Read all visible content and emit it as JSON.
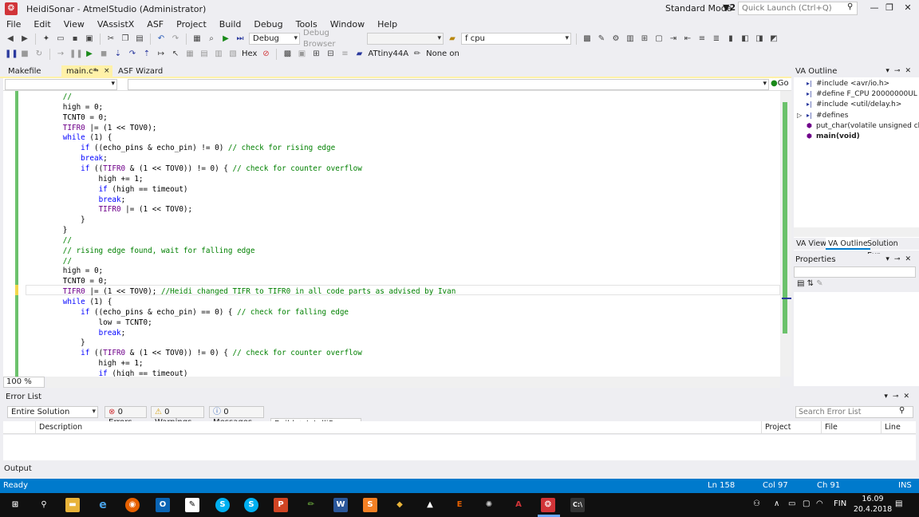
{
  "window": {
    "title": "HeidiSonar - AtmelStudio (Administrator)",
    "mode": "Standard Mode",
    "notification": "▼2",
    "quick_launch_placeholder": "Quick Launch (Ctrl+Q)",
    "minimize": "—",
    "restore": "❐",
    "close": "✕"
  },
  "menu": [
    "File",
    "Edit",
    "View",
    "VAssistX",
    "ASF",
    "Project",
    "Build",
    "Debug",
    "Tools",
    "Window",
    "Help"
  ],
  "toolbar1": {
    "config": "Debug",
    "debug_browser": "Debug Browser",
    "find_text": "f cpu"
  },
  "toolbar2": {
    "hex": "Hex",
    "device": "ATtiny44A",
    "tool": "None on"
  },
  "tabs": {
    "makefile": "Makefile",
    "mainc": "main.c*",
    "asf": "ASF Wizard",
    "pin": "⊸",
    "close": "×"
  },
  "nav": {
    "go": "Go"
  },
  "code": [
    "        //",
    "        high = 0;",
    "        TCNT0 = 0;",
    "        TIFR0 |= (1 << TOV0);",
    "        while (1) {",
    "            if ((echo_pins & echo_pin) != 0) // check for rising edge",
    "            break;",
    "            if ((TIFR0 & (1 << TOV0)) != 0) { // check for counter overflow",
    "                high += 1;",
    "                if (high == timeout)",
    "                break;",
    "                TIFR0 |= (1 << TOV0);",
    "            }",
    "        }",
    "        //",
    "        // rising edge found, wait for falling edge",
    "        //",
    "        high = 0;",
    "        TCNT0 = 0;",
    "        TIFR0 |= (1 << TOV0); //Heidi changed TIFR to TIFR0 in all code parts as advised by Ivan",
    "        while (1) {",
    "            if ((echo_pins & echo_pin) == 0) { // check for falling edge",
    "                low = TCNT0;",
    "                break;",
    "            }",
    "            if ((TIFR0 & (1 << TOV0)) != 0) { // check for counter overflow",
    "                high += 1;",
    "                if (high == timeout)"
  ],
  "zoom": "100 %",
  "va_outline": {
    "title": "VA Outline",
    "items": [
      "#include <avr/io.h>",
      "#define F_CPU 20000000UL //H",
      "#include <util/delay.h>",
      "#defines",
      "put_char(volatile unsigned cha",
      "main(void)"
    ],
    "tabs": [
      "VA View",
      "VA Outline",
      "Solution Exp..."
    ]
  },
  "properties": {
    "title": "Properties"
  },
  "error_list": {
    "title": "Error List",
    "scope": "Entire Solution",
    "errors": "0 Errors",
    "warnings": "0 Warnings",
    "messages": "0 Messages",
    "build_filter": "Build + IntelliSense",
    "search_placeholder": "Search Error List",
    "columns": [
      "Description",
      "Project",
      "File",
      "Line"
    ]
  },
  "output": "Output",
  "status": {
    "ready": "Ready",
    "line": "Ln 158",
    "col": "Col 97",
    "ch": "Ch 91",
    "ins": "INS"
  },
  "taskbar": {
    "time": "16.09",
    "date": "20.4.2018",
    "lang": "FIN"
  },
  "colors": {
    "accent": "#007acc",
    "change_margin": "#6cc26c",
    "active_tab": "#fff1a8",
    "keyword": "#0000ff",
    "comment": "#008000"
  }
}
